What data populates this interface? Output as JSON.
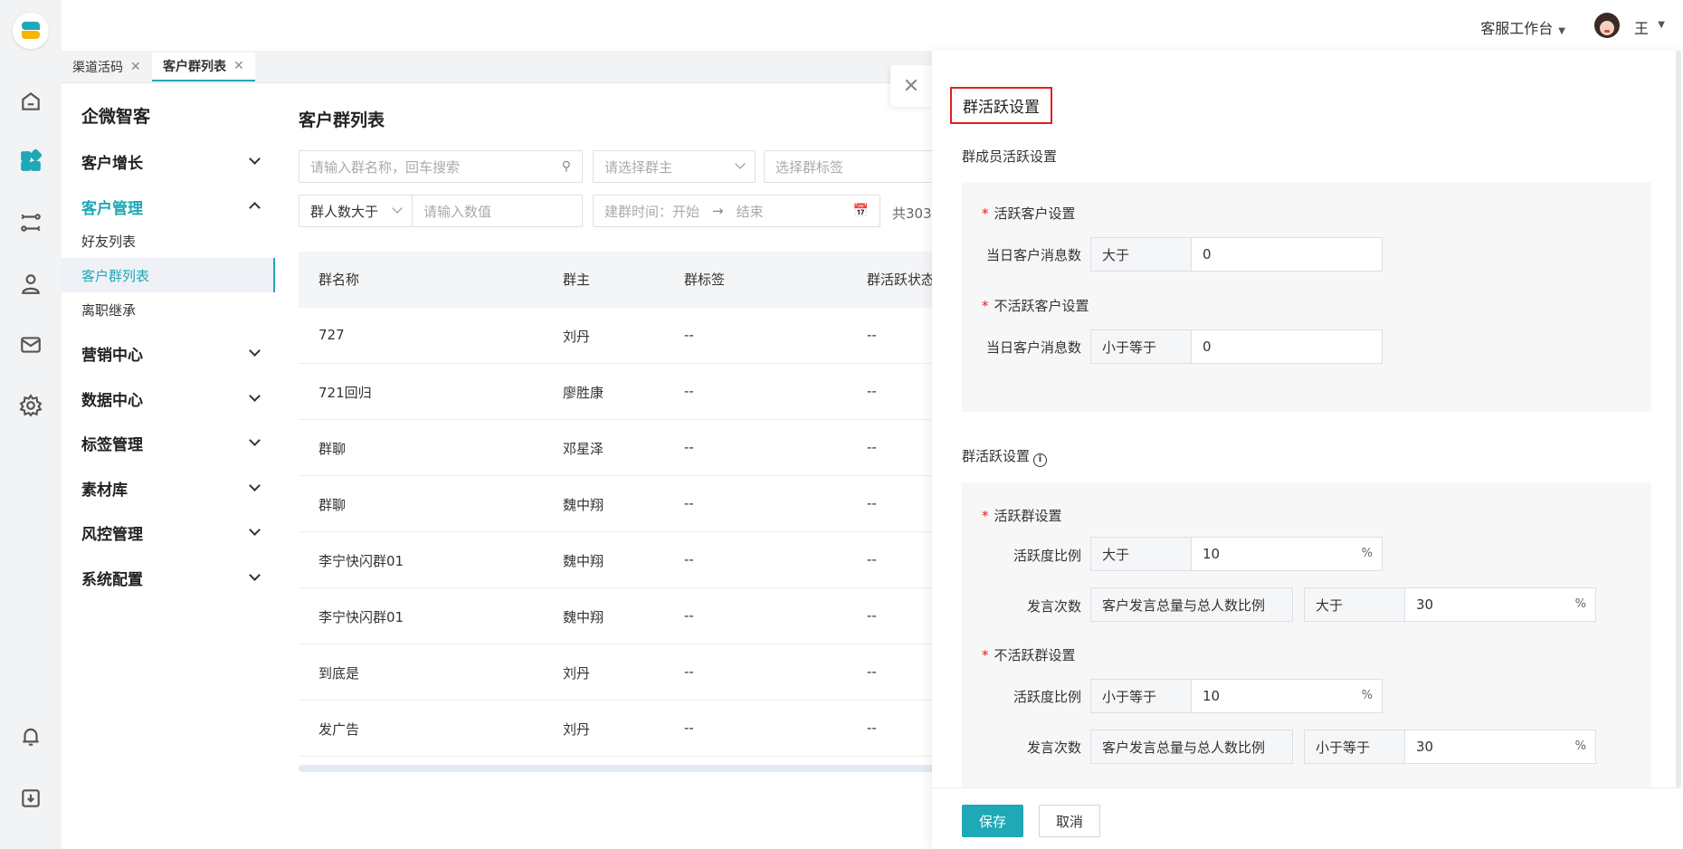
{
  "header": {
    "workbench_label": "客服工作台",
    "username": "王"
  },
  "tabs": [
    {
      "label": "渠道活码",
      "active": false
    },
    {
      "label": "客户群列表",
      "active": true
    }
  ],
  "sidebar": {
    "brand": "企微智客",
    "groups": [
      {
        "label": "客户增长"
      },
      {
        "label": "客户管理",
        "items": [
          "好友列表",
          "客户群列表",
          "离职继承"
        ]
      },
      {
        "label": "营销中心"
      },
      {
        "label": "数据中心"
      },
      {
        "label": "标签管理"
      },
      {
        "label": "素材库"
      },
      {
        "label": "风控管理"
      },
      {
        "label": "系统配置"
      }
    ]
  },
  "main": {
    "title": "客户群列表",
    "filters": {
      "search_placeholder": "请输入群名称，回车搜索",
      "owner_placeholder": "请选择群主",
      "tag_placeholder": "选择群标签",
      "count_select": "群人数大于",
      "count_placeholder": "请输入数值",
      "date_start": "建群时间：开始",
      "date_end": "结束",
      "total": "共303"
    },
    "columns": [
      "群名称",
      "群主",
      "群标签",
      "群活跃状态"
    ],
    "rows": [
      [
        "727",
        "刘丹",
        "--",
        "--"
      ],
      [
        "721回归",
        "廖胜康",
        "--",
        "--"
      ],
      [
        "群聊",
        "邓星泽",
        "--",
        "--"
      ],
      [
        "群聊",
        "魏中翔",
        "--",
        "--"
      ],
      [
        "李宁快闪群01",
        "魏中翔",
        "--",
        "--"
      ],
      [
        "李宁快闪群01",
        "魏中翔",
        "--",
        "--"
      ],
      [
        "到底是",
        "刘丹",
        "--",
        "--"
      ],
      [
        "发广告",
        "刘丹",
        "--",
        "--"
      ]
    ]
  },
  "drawer": {
    "title": "群活跃设置",
    "member_section": {
      "title": "群成员活跃设置",
      "active_label": "活跃客户设置",
      "active_field_label": "当日客户消息数",
      "active_op": "大于",
      "active_value": "0",
      "inactive_label": "不活跃客户设置",
      "inactive_field_label": "当日客户消息数",
      "inactive_op": "小于等于",
      "inactive_value": "0"
    },
    "group_section": {
      "title": "群活跃设置",
      "active_label": "活跃群设置",
      "active_ratio_label": "活跃度比例",
      "active_ratio_op": "大于",
      "active_ratio_value": "10",
      "active_speak_label": "发言次数",
      "active_speak_metric": "客户发言总量与总人数比例",
      "active_speak_op": "大于",
      "active_speak_value": "30",
      "inactive_label": "不活跃群设置",
      "inactive_ratio_label": "活跃度比例",
      "inactive_ratio_op": "小于等于",
      "inactive_ratio_value": "10",
      "inactive_speak_label": "发言次数",
      "inactive_speak_metric": "客户发言总量与总人数比例",
      "inactive_speak_op": "小于等于",
      "inactive_speak_value": "30",
      "percent_unit": "%"
    },
    "save_label": "保存",
    "cancel_label": "取消"
  },
  "colors": {
    "accent": "#1fa8b5",
    "highlight_border": "#e02020"
  }
}
